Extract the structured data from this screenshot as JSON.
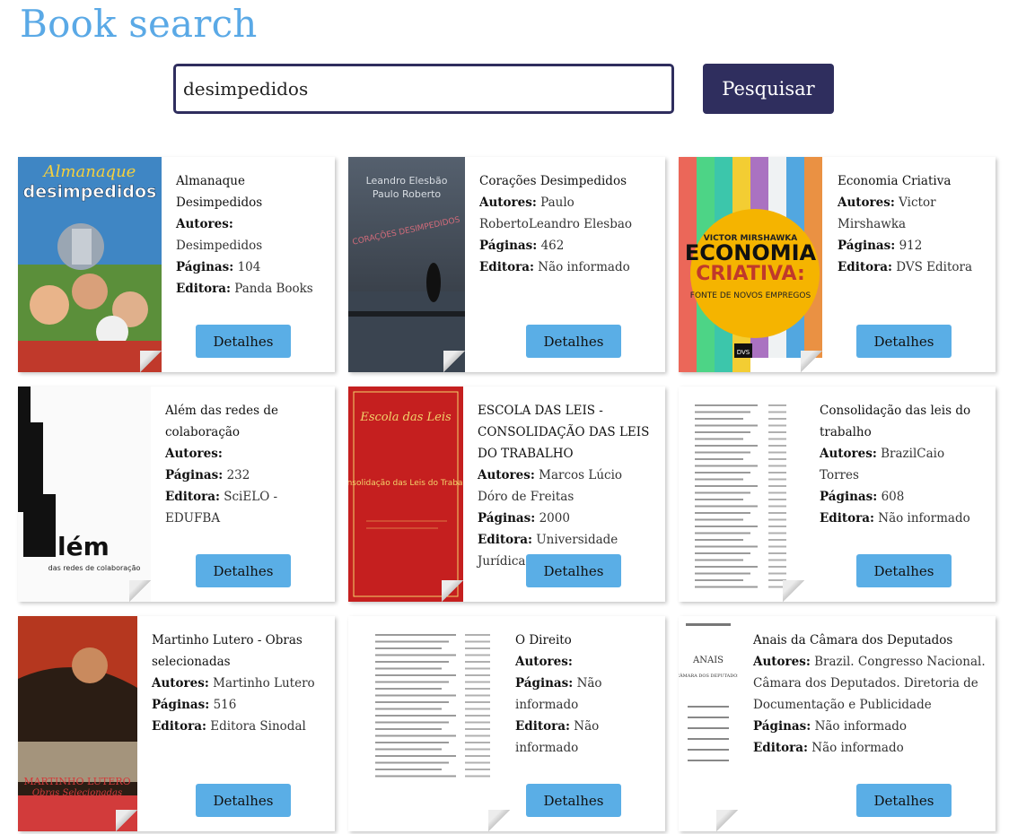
{
  "header": {
    "title": "Book search"
  },
  "search": {
    "value": "desimpedidos",
    "button_label": "Pesquisar"
  },
  "labels": {
    "authors": "Autores:",
    "pages": "Páginas:",
    "publisher": "Editora:",
    "details": "Detalhes"
  },
  "books": [
    {
      "title": "Almanaque Desimpedidos",
      "authors": "Desimpedidos",
      "pages": "104",
      "publisher": "Panda Books",
      "cover": {
        "kind": "almanaque",
        "text1": "Almanaque",
        "text2": "desimpedidos"
      }
    },
    {
      "title": "Corações Desimpedidos",
      "authors": "Paulo RobertoLeandro Elesbao",
      "pages": "462",
      "publisher": "Não informado",
      "cover": {
        "kind": "coracoes",
        "text1": "Leandro Elesbão",
        "text2": "Paulo Roberto",
        "text3": "CORAÇÕES DESIMPEDIDOS"
      }
    },
    {
      "title": "Economia Criativa",
      "authors": "Victor Mirshawka",
      "pages": "912",
      "publisher": "DVS Editora",
      "cover": {
        "kind": "economia",
        "text1": "VICTOR MIRSHAWKA",
        "text2": "ECONOMIA",
        "text3": "CRIATIVA:",
        "text4": "FONTE DE NOVOS EMPREGOS",
        "text5": "DVS"
      }
    },
    {
      "title": "Além das redes de colaboração",
      "authors": "",
      "pages": "232",
      "publisher": "SciELO - EDUFBA",
      "cover": {
        "kind": "alem",
        "text1": "lém",
        "text2": "das redes de colaboração"
      }
    },
    {
      "title": "ESCOLA DAS LEIS - CONSOLIDAÇÃO DAS LEIS DO TRABALHO",
      "authors": "Marcos Lúcio Dóro de Freitas",
      "pages": "2000",
      "publisher": "Universidade Jurídica",
      "cover": {
        "kind": "escola",
        "text1": "Escola das Leis",
        "text2": "Consolidação das Leis do Trabalho"
      }
    },
    {
      "title": "Consolidação das leis do trabalho",
      "authors": "BrazilCaio Torres",
      "pages": "608",
      "publisher": "Não informado",
      "cover": {
        "kind": "scan"
      }
    },
    {
      "title": "Martinho Lutero - Obras selecionadas",
      "authors": "Martinho Lutero",
      "pages": "516",
      "publisher": "Editora Sinodal",
      "cover": {
        "kind": "lutero",
        "text1": "MARTINHO LUTERO",
        "text2": "Obras Selecionadas"
      }
    },
    {
      "title": "O Direito",
      "authors": "",
      "pages": "Não informado",
      "publisher": "Não informado",
      "cover": {
        "kind": "scan2"
      }
    },
    {
      "title": "Anais da Câmara dos Deputados",
      "authors": "Brazil. Congresso Nacional. Câmara dos Deputados. Diretoria de Documentação e Publicidade",
      "pages": "Não informado",
      "publisher": "Não informado",
      "cover": {
        "kind": "anais",
        "text1": "ANAIS",
        "text2": "CÂMARA DOS DEPUTADOS"
      }
    }
  ],
  "colors": {
    "accent": "#5aa9e6",
    "dark": "#2f2e5e",
    "button": "#5aaee6"
  }
}
